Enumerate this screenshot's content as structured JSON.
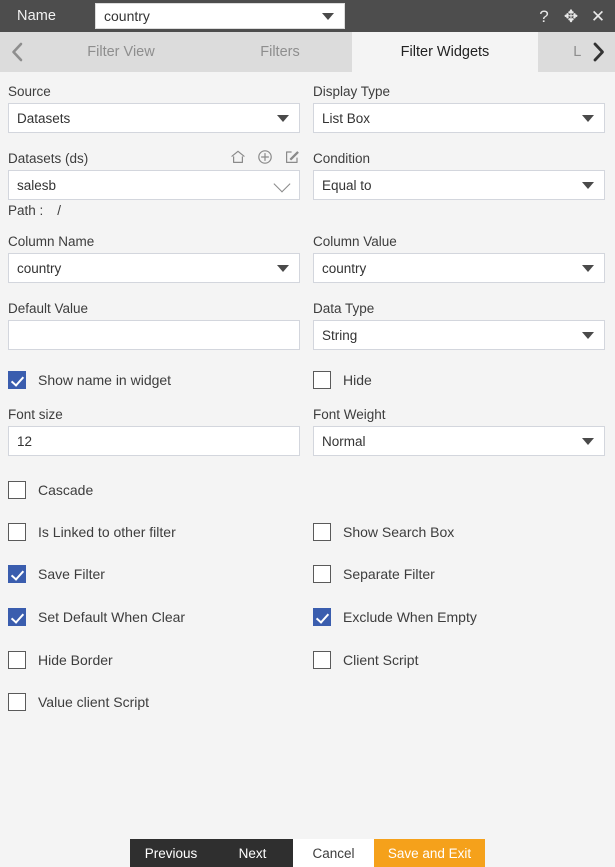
{
  "titlebar": {
    "name_label": "Name",
    "name_value": "country",
    "icons": [
      {
        "name": "help-icon",
        "glyph": "?"
      },
      {
        "name": "move-icon",
        "glyph": "✥"
      },
      {
        "name": "close-icon",
        "glyph": "✕"
      }
    ]
  },
  "tabs": {
    "prev_arrow": "‹",
    "next_arrow": "›",
    "items": [
      {
        "label": "Filter View",
        "active": false
      },
      {
        "label": "Filters",
        "active": false
      },
      {
        "label": "Filter Widgets",
        "active": true
      },
      {
        "label": "Link Filters and Widge",
        "active": false
      }
    ]
  },
  "form": {
    "source": {
      "label": "Source",
      "value": "Datasets"
    },
    "display_type": {
      "label": "Display Type",
      "value": "List Box"
    },
    "datasets": {
      "label": "Datasets (ds)",
      "value": "salesb",
      "path_label": "Path :",
      "path_value": "/",
      "icons": [
        {
          "name": "home-icon"
        },
        {
          "name": "add-circle-icon"
        },
        {
          "name": "edit-icon"
        }
      ]
    },
    "condition": {
      "label": "Condition",
      "value": "Equal to"
    },
    "column_name": {
      "label": "Column Name",
      "value": "country"
    },
    "column_value": {
      "label": "Column Value",
      "value": "country"
    },
    "default_value": {
      "label": "Default Value",
      "value": ""
    },
    "data_type": {
      "label": "Data Type",
      "value": "String"
    },
    "font_size": {
      "label": "Font size",
      "value": "12"
    },
    "font_weight": {
      "label": "Font Weight",
      "value": "Normal"
    }
  },
  "checkboxes": [
    {
      "label": "Show name in widget",
      "checked": true
    },
    {
      "label": "Hide",
      "checked": false
    },
    {
      "label": "Cascade",
      "checked": false
    },
    {
      "label": "Is Linked to other filter",
      "checked": false
    },
    {
      "label": "Show Search Box",
      "checked": false
    },
    {
      "label": "Save Filter",
      "checked": true
    },
    {
      "label": "Separate Filter",
      "checked": false
    },
    {
      "label": "Set Default When Clear",
      "checked": true
    },
    {
      "label": "Exclude When Empty",
      "checked": true
    },
    {
      "label": "Hide Border",
      "checked": false
    },
    {
      "label": "Client Script",
      "checked": false
    },
    {
      "label": "Value client Script",
      "checked": false
    }
  ],
  "footer": {
    "previous": "Previous",
    "next": "Next",
    "cancel": "Cancel",
    "save_and_exit": "Save and Exit"
  },
  "colors": {
    "titlebar_bg": "#4d4d4d",
    "tabbar_bg": "#dcdcdc",
    "page_bg": "#f4f4f4",
    "checkbox_accent": "#3a5dae",
    "accent_button": "#f5a11b",
    "dark_button": "#2f2f2f"
  }
}
